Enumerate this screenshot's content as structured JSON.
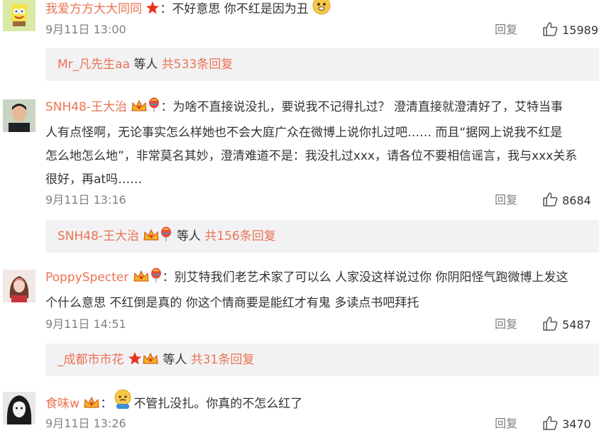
{
  "comments": [
    {
      "username": "我爱方方大大同同",
      "text": "：不好意思 你不红是因为丑",
      "time": "9月11日 13:00",
      "reply_label": "回复",
      "likes": "15989",
      "thread": {
        "username": "Mr_凡先生aa",
        "etc": " 等人 ",
        "total": "共533条回复"
      }
    },
    {
      "username": "SNH48-王大治",
      "text_lines": [
        "：为啥不直接说没扎，要说我不记得扎过？ 澄清直接就澄清好了，艾特当事",
        "人有点怪啊，无论事实怎么样她也不会大庭广众在微博上说你扎过吧…… 而且“据网上说我不红是",
        "怎么地怎么地”，非常莫名其妙，澄清难道不是：我没扎过xxx，请各位不要相信谣言，我与xxx关系",
        "很好，再at吗……"
      ],
      "time": "9月11日 13:16",
      "reply_label": "回复",
      "likes": "8684",
      "thread": {
        "username": "SNH48-王大治",
        "etc": " 等人 ",
        "total": "共156条回复"
      }
    },
    {
      "username": "PoppySpecter",
      "text_lines": [
        "：别艾特我们老艺术家了可以么 人家没这样说过你 你阴阳怪气跑微博上发这",
        "个什么意思 不红倒是真的 你这个情商要是能红才有鬼 多读点书吧拜托"
      ],
      "time": "9月11日 14:51",
      "reply_label": "回复",
      "likes": "5487",
      "thread": {
        "username": "_成都市市花",
        "etc": " 等人 ",
        "total": "共31条回复"
      }
    },
    {
      "username": "食味w",
      "text": "不管扎没扎。你真的不怎么红了",
      "time": "9月11日 13:26",
      "reply_label": "回复",
      "likes": "3470"
    }
  ],
  "colors": {
    "username": "#eb7350",
    "meta": "#808080",
    "subbox_bg": "#f2f2f5"
  },
  "icons": [
    "thumbs-up-icon",
    "red-star-badge-icon",
    "crown-badge-icon",
    "balloon-badge-icon",
    "emoji-icon"
  ]
}
